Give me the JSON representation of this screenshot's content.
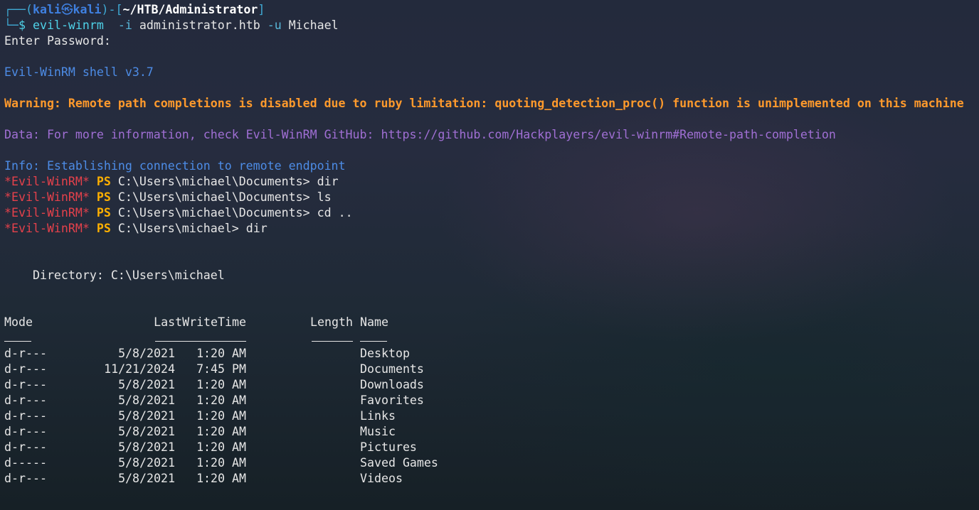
{
  "prompt": {
    "frame_open": "┌──(",
    "user": "kali",
    "skull": "㉿",
    "host": "kali",
    "frame_mid": ")-[",
    "cwd": "~/HTB/Administrator",
    "frame_close": "]",
    "frame_bottom": "└─",
    "dollar": "$",
    "command": "evil-winrm",
    "arg1_flag": "-i",
    "arg1_value": "administrator.htb",
    "arg2_flag": "-u",
    "arg2_value": "Michael"
  },
  "output": {
    "enter_password": "Enter Password:",
    "shell_version": "Evil-WinRM shell v3.7",
    "warning": "Warning: Remote path completions is disabled due to ruby limitation: quoting_detection_proc() function is unimplemented on this machine",
    "data": "Data: For more information, check Evil-WinRM GitHub: https://github.com/Hackplayers/evil-winrm#Remote-path-completion",
    "info": "Info: Establishing connection to remote endpoint"
  },
  "ps_prompt": {
    "name": "*Evil-WinRM*",
    "ps": "PS",
    "commands": [
      {
        "path": "C:\\Users\\michael\\Documents>",
        "cmd": "dir"
      },
      {
        "path": "C:\\Users\\michael\\Documents>",
        "cmd": "ls"
      },
      {
        "path": "C:\\Users\\michael\\Documents>",
        "cmd": "cd .."
      },
      {
        "path": "C:\\Users\\michael>",
        "cmd": "dir"
      }
    ]
  },
  "listing": {
    "directory_label": "    Directory: C:\\Users\\michael",
    "headers": {
      "mode": "Mode",
      "lastwritetime": "LastWriteTime",
      "length": "Length",
      "name": "Name"
    },
    "rows": [
      {
        "mode": "d-r---",
        "date": "5/8/2021",
        "time": "1:20 AM",
        "length": "",
        "name": "Desktop"
      },
      {
        "mode": "d-r---",
        "date": "11/21/2024",
        "time": "7:45 PM",
        "length": "",
        "name": "Documents"
      },
      {
        "mode": "d-r---",
        "date": "5/8/2021",
        "time": "1:20 AM",
        "length": "",
        "name": "Downloads"
      },
      {
        "mode": "d-r---",
        "date": "5/8/2021",
        "time": "1:20 AM",
        "length": "",
        "name": "Favorites"
      },
      {
        "mode": "d-r---",
        "date": "5/8/2021",
        "time": "1:20 AM",
        "length": "",
        "name": "Links"
      },
      {
        "mode": "d-r---",
        "date": "5/8/2021",
        "time": "1:20 AM",
        "length": "",
        "name": "Music"
      },
      {
        "mode": "d-r---",
        "date": "5/8/2021",
        "time": "1:20 AM",
        "length": "",
        "name": "Pictures"
      },
      {
        "mode": "d-----",
        "date": "5/8/2021",
        "time": "1:20 AM",
        "length": "",
        "name": "Saved Games"
      },
      {
        "mode": "d-r---",
        "date": "5/8/2021",
        "time": "1:20 AM",
        "length": "",
        "name": "Videos"
      }
    ]
  }
}
